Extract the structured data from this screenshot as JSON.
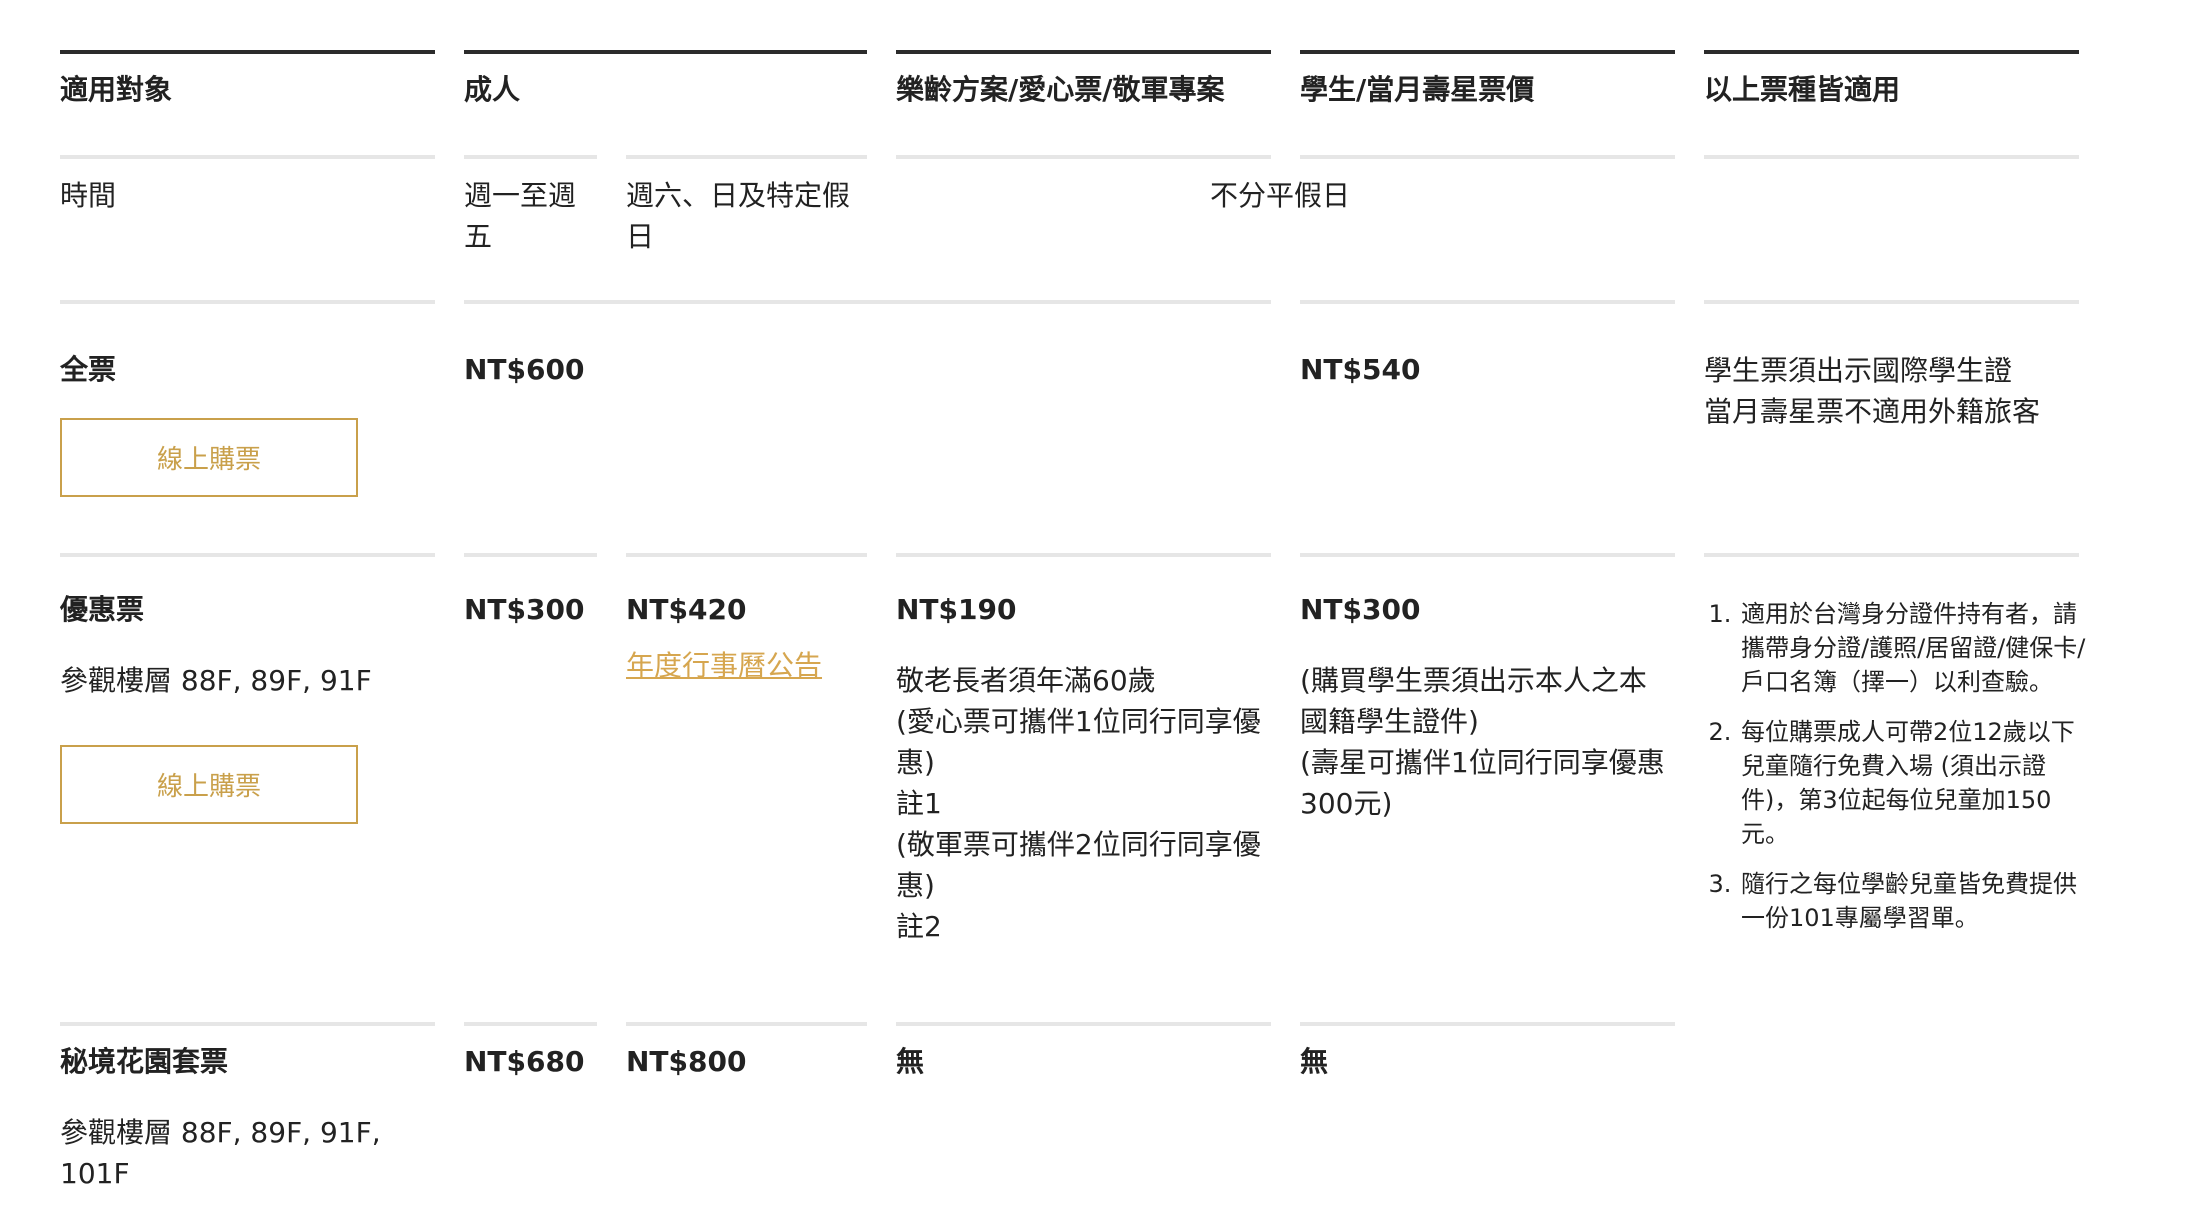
{
  "headers": {
    "target": "適用對象",
    "adult": "成人",
    "senior": "樂齡方案/愛心票/敬軍專案",
    "student": "學生/當月壽星票價",
    "all": "以上票種皆適用"
  },
  "time_row": {
    "label": "時間",
    "weekday": "週一至週五",
    "weekend": "週六、日及特定假日",
    "no_distinction": "不分平假日"
  },
  "full_ticket": {
    "label": "全票",
    "buy_label": "線上購票",
    "adult_price": "NT$600",
    "student_price": "NT$540",
    "note_line1": "學生票須出示國際學生證",
    "note_line2": "當月壽星票不適用外籍旅客"
  },
  "discount_ticket": {
    "label": "優惠票",
    "floors": "參觀樓層 88F, 89F, 91F",
    "buy_label": "線上購票",
    "weekday_price": "NT$300",
    "weekend_price": "NT$420",
    "calendar_link": "年度行事曆公告",
    "senior_price": "NT$190",
    "senior_lines": [
      "敬老長者須年滿60歲",
      "(愛心票可攜伴1位同行同享優惠)",
      "註1",
      "(敬軍票可攜伴2位同行同享優惠)",
      "註2"
    ],
    "student_price": "NT$300",
    "student_lines": [
      "(購買學生票須出示本人之本國籍學生證件)",
      "(壽星可攜伴1位同行同享優惠300元)"
    ],
    "notes": [
      "適用於台灣身分證件持有者，請攜帶身分證/護照/居留證/健保卡/戶口名簿（擇一）以利查驗。",
      "每位購票成人可帶2位12歲以下兒童隨行免費入場 (須出示證件)，第3位起每位兒童加150元。",
      "隨行之每位學齡兒童皆免費提供一份101專屬學習單。"
    ]
  },
  "garden_ticket": {
    "label": "秘境花園套票",
    "floors": "參觀樓層 88F, 89F, 91F, 101F",
    "weekday_price": "NT$680",
    "weekend_price": "NT$800",
    "senior_value": "無",
    "student_value": "無"
  }
}
